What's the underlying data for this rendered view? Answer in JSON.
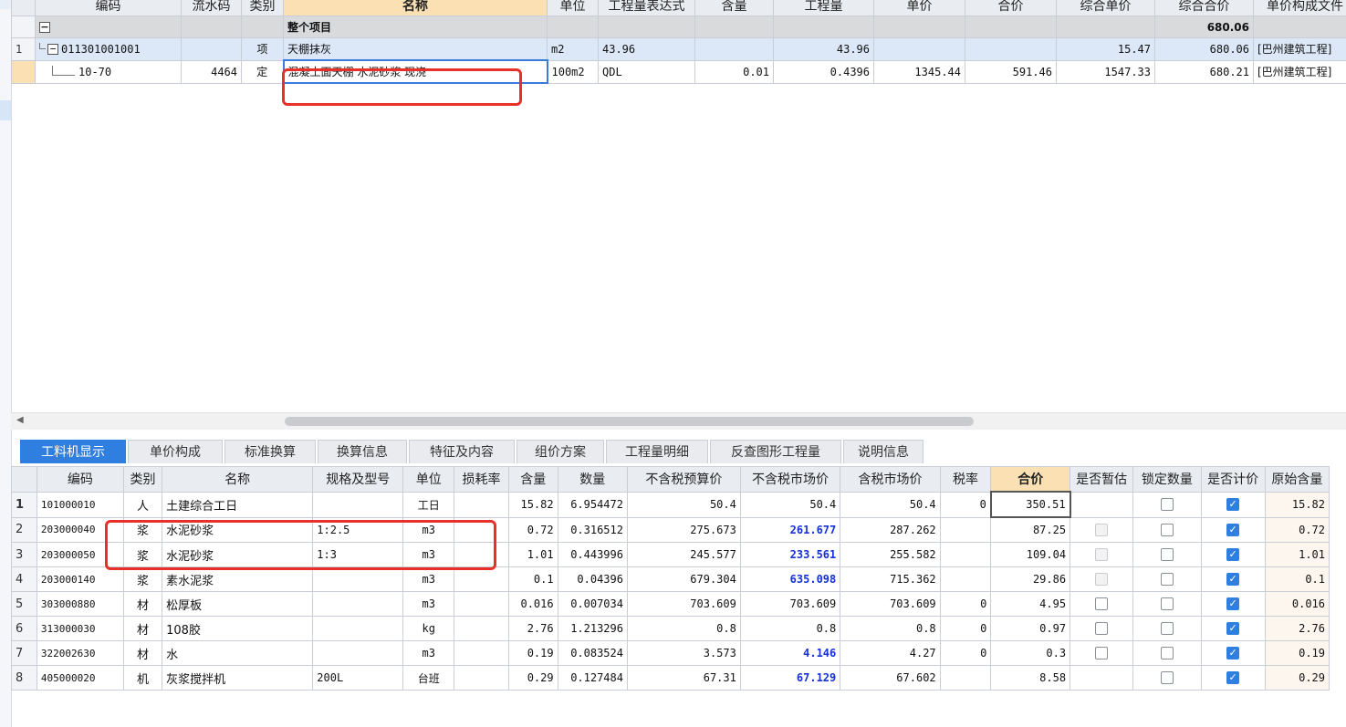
{
  "top_grid": {
    "headers": [
      "编码",
      "流水码",
      "类别",
      "名称",
      "单位",
      "工程量表达式",
      "含量",
      "工程量",
      "单价",
      "合价",
      "综合单价",
      "综合合价",
      "单价构成文件"
    ],
    "summary_row": {
      "code": "",
      "name": "整个项目",
      "total": "680.06"
    },
    "item_row": {
      "no": "1",
      "code": "011301001001",
      "kind": "项",
      "name": "天棚抹灰",
      "unit": "m2",
      "expr": "43.96",
      "qty": "43.96",
      "unit_price_comp": "15.47",
      "total_comp": "680.06",
      "file": "[巴州建筑工程]"
    },
    "quota_row": {
      "code": "10-70",
      "serial": "4464",
      "kind": "定",
      "name": "混凝土面天棚 水泥砂浆 现浇",
      "unit": "100m2",
      "expr": "QDL",
      "content": "0.01",
      "qty": "0.4396",
      "price": "1345.44",
      "amount": "591.46",
      "unit_price_comp": "1547.33",
      "total_comp": "680.21",
      "file": "[巴州建筑工程]"
    }
  },
  "tabs": [
    "工料机显示",
    "单价构成",
    "标准换算",
    "换算信息",
    "特征及内容",
    "组价方案",
    "工程量明细",
    "反查图形工程量",
    "说明信息"
  ],
  "bottom_grid": {
    "headers": [
      "编码",
      "类别",
      "名称",
      "规格及型号",
      "单位",
      "损耗率",
      "含量",
      "数量",
      "不含税预算价",
      "不含税市场价",
      "含税市场价",
      "税率",
      "合价",
      "是否暂估",
      "锁定数量",
      "是否计价",
      "原始含量"
    ],
    "rows": [
      {
        "no": "1",
        "code": "101000010",
        "kind": "人",
        "name": "土建综合工日",
        "spec": "",
        "unit": "工日",
        "loss": "",
        "content": "15.82",
        "qty": "6.954472",
        "budget": "50.4",
        "market": "50.4",
        "market_tax": "50.4",
        "tax": "0",
        "amount": "350.51",
        "orig": "15.82"
      },
      {
        "no": "2",
        "code": "203000040",
        "kind": "浆",
        "name": "水泥砂浆",
        "spec": "1:2.5",
        "unit": "m3",
        "loss": "",
        "content": "0.72",
        "qty": "0.316512",
        "budget": "275.673",
        "market": "261.677",
        "market_tax": "287.262",
        "tax": "",
        "amount": "87.25",
        "orig": "0.72"
      },
      {
        "no": "3",
        "code": "203000050",
        "kind": "浆",
        "name": "水泥砂浆",
        "spec": "1:3",
        "unit": "m3",
        "loss": "",
        "content": "1.01",
        "qty": "0.443996",
        "budget": "245.577",
        "market": "233.561",
        "market_tax": "255.582",
        "tax": "",
        "amount": "109.04",
        "orig": "1.01"
      },
      {
        "no": "4",
        "code": "203000140",
        "kind": "浆",
        "name": "素水泥浆",
        "spec": "",
        "unit": "m3",
        "loss": "",
        "content": "0.1",
        "qty": "0.04396",
        "budget": "679.304",
        "market": "635.098",
        "market_tax": "715.362",
        "tax": "",
        "amount": "29.86",
        "orig": "0.1"
      },
      {
        "no": "5",
        "code": "303000880",
        "kind": "材",
        "name": "松厚板",
        "spec": "",
        "unit": "m3",
        "loss": "",
        "content": "0.016",
        "qty": "0.007034",
        "budget": "703.609",
        "market": "703.609",
        "market_tax": "703.609",
        "tax": "0",
        "amount": "4.95",
        "orig": "0.016"
      },
      {
        "no": "6",
        "code": "313000030",
        "kind": "材",
        "name": "108胶",
        "spec": "",
        "unit": "kg",
        "loss": "",
        "content": "2.76",
        "qty": "1.213296",
        "budget": "0.8",
        "market": "0.8",
        "market_tax": "0.8",
        "tax": "0",
        "amount": "0.97",
        "orig": "2.76"
      },
      {
        "no": "7",
        "code": "322002630",
        "kind": "材",
        "name": "水",
        "spec": "",
        "unit": "m3",
        "loss": "",
        "content": "0.19",
        "qty": "0.083524",
        "budget": "3.573",
        "market": "4.146",
        "market_tax": "4.27",
        "tax": "0",
        "amount": "0.3",
        "orig": "0.19"
      },
      {
        "no": "8",
        "code": "405000020",
        "kind": "机",
        "name": "灰浆搅拌机",
        "spec": "200L",
        "unit": "台班",
        "loss": "",
        "content": "0.29",
        "qty": "0.127484",
        "budget": "67.31",
        "market": "67.129",
        "market_tax": "67.602",
        "tax": "",
        "amount": "8.58",
        "orig": "0.29"
      }
    ]
  }
}
